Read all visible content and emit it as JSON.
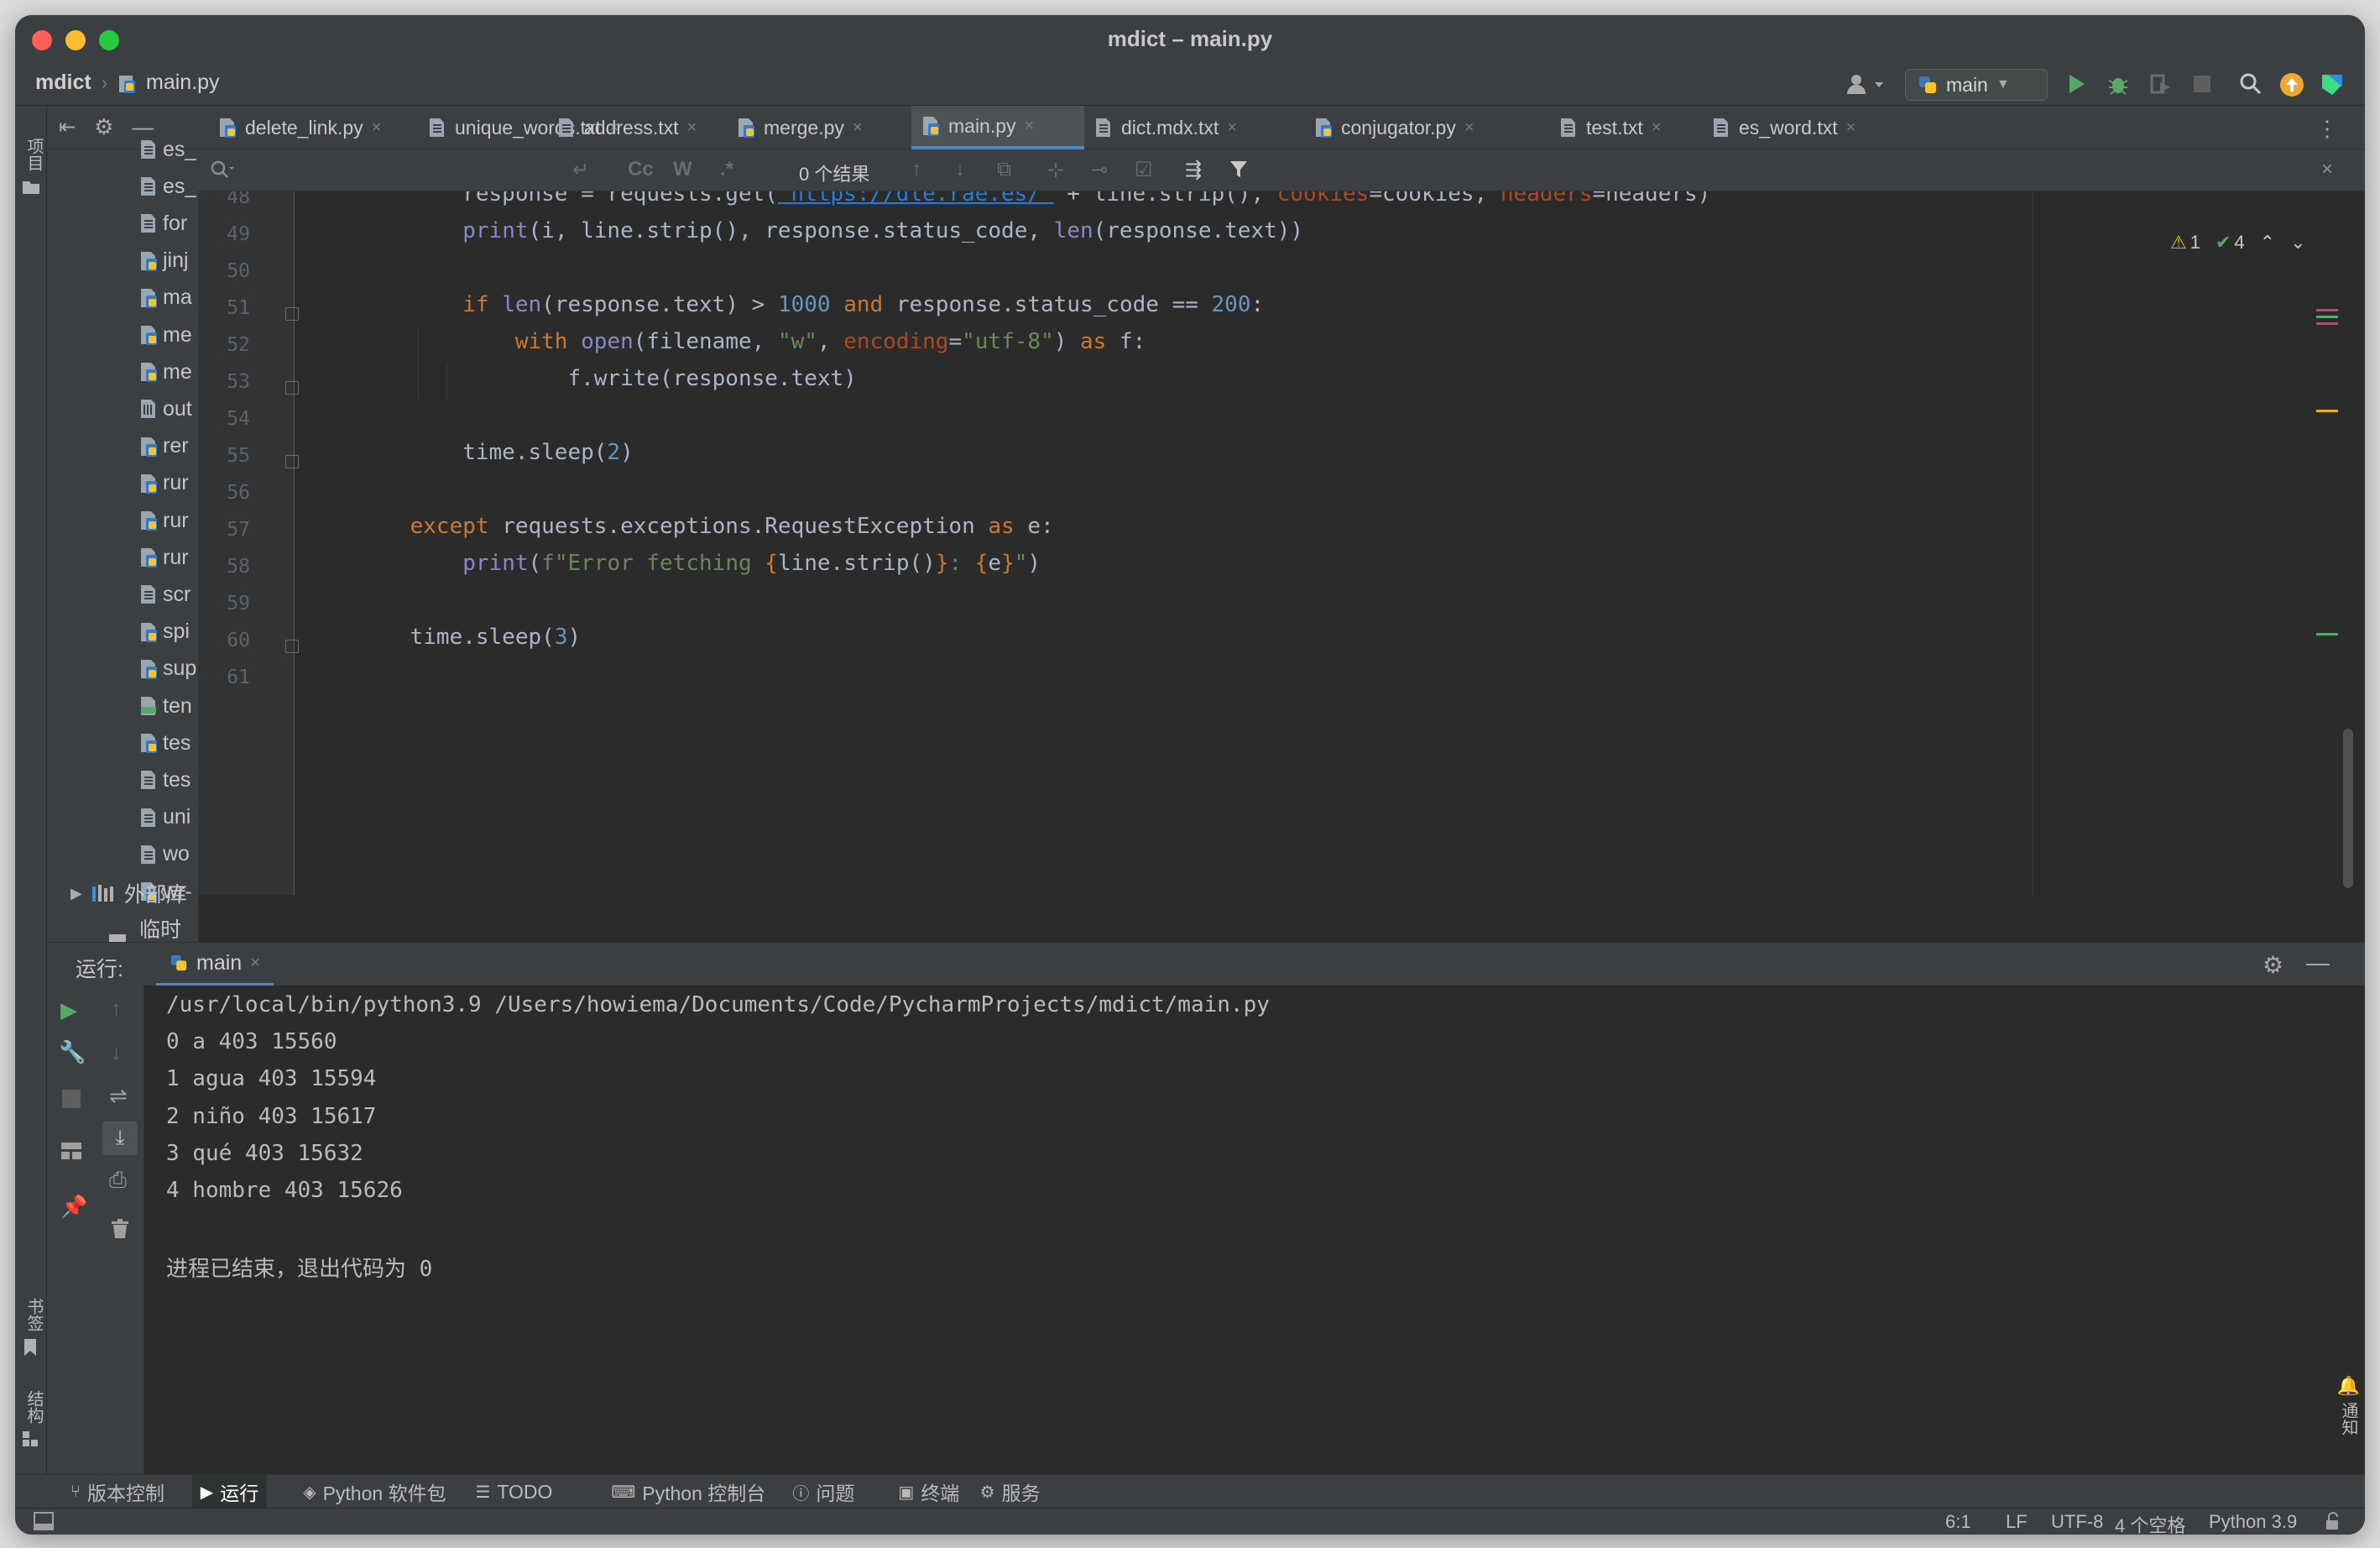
{
  "window": {
    "title": "mdict – main.py",
    "traffic_lights": {
      "close": "#ff5f57",
      "minimize": "#febc2e",
      "zoom": "#28c840"
    }
  },
  "navbar": {
    "project": "mdict",
    "file": "main.py",
    "run_config": "main",
    "icons": [
      "user-icon",
      "run-icon",
      "debug-icon",
      "coverage-icon",
      "stop-icon",
      "search-icon",
      "update-icon",
      "jetbrains-logo-icon"
    ]
  },
  "left_strip": {
    "project_label": "项目",
    "bookmarks_label": "书签",
    "structure_label": "结构"
  },
  "project_tree": {
    "items": [
      {
        "label": "es_",
        "icon": "text-file-icon"
      },
      {
        "label": "es_",
        "icon": "text-file-icon"
      },
      {
        "label": "for",
        "icon": "text-file-icon"
      },
      {
        "label": "jinj",
        "icon": "python-file-icon"
      },
      {
        "label": "ma",
        "icon": "python-file-icon"
      },
      {
        "label": "me",
        "icon": "python-file-icon"
      },
      {
        "label": "me",
        "icon": "python-file-icon"
      },
      {
        "label": "out",
        "icon": "binary-file-icon"
      },
      {
        "label": "rer",
        "icon": "python-file-icon"
      },
      {
        "label": "rur",
        "icon": "python-file-icon"
      },
      {
        "label": "rur",
        "icon": "python-file-icon"
      },
      {
        "label": "rur",
        "icon": "python-file-icon"
      },
      {
        "label": "scr",
        "icon": "text-file-icon"
      },
      {
        "label": "spi",
        "icon": "python-file-icon"
      },
      {
        "label": "sup",
        "icon": "python-file-icon"
      },
      {
        "label": "ten",
        "icon": "html-file-icon"
      },
      {
        "label": "tes",
        "icon": "python-file-icon"
      },
      {
        "label": "tes",
        "icon": "text-file-icon"
      },
      {
        "label": "uni",
        "icon": "text-file-icon"
      },
      {
        "label": "wo",
        "icon": "text-file-icon"
      },
      {
        "label": "wr-",
        "icon": "python-file-icon"
      }
    ],
    "external_libraries": "外部库",
    "scratches": "临时文"
  },
  "tabs": [
    {
      "label": "delete_link.py",
      "icon": "python-file-icon",
      "active": false
    },
    {
      "label": "unique_words.txt",
      "icon": "text-file-icon",
      "active": false
    },
    {
      "label": "address.txt",
      "icon": "text-file-icon",
      "active": false
    },
    {
      "label": "merge.py",
      "icon": "python-file-icon",
      "active": false
    },
    {
      "label": "main.py",
      "icon": "python-file-icon",
      "active": true
    },
    {
      "label": "dict.mdx.txt",
      "icon": "text-file-icon",
      "active": false
    },
    {
      "label": "conjugator.py",
      "icon": "python-file-icon",
      "active": false
    },
    {
      "label": "test.txt",
      "icon": "text-file-icon",
      "active": false
    },
    {
      "label": "es_word.txt",
      "icon": "text-file-icon",
      "active": false
    }
  ],
  "find_bar": {
    "query": "",
    "results": "0 个结果",
    "match_case": "Cc",
    "words": "W",
    "regex": ".*"
  },
  "inspections": {
    "warnings": "1",
    "ok": "4"
  },
  "editor": {
    "line_numbers": [
      "48",
      "49",
      "50",
      "51",
      "52",
      "53",
      "54",
      "55",
      "56",
      "57",
      "58",
      "59",
      "60",
      "61"
    ],
    "lines": [
      [
        {
          "t": "        response = requests.get(",
          "c": ""
        },
        {
          "t": "\"https://dle.rae.es/\"",
          "c": "url"
        },
        {
          "t": " + line.strip(), ",
          "c": ""
        },
        {
          "t": "cookies",
          "c": "pm"
        },
        {
          "t": "=cookies, ",
          "c": ""
        },
        {
          "t": "headers",
          "c": "pm"
        },
        {
          "t": "=headers)",
          "c": ""
        }
      ],
      [
        {
          "t": "        ",
          "c": ""
        },
        {
          "t": "print",
          "c": "bi"
        },
        {
          "t": "(i, line.strip(), response.status_code, ",
          "c": ""
        },
        {
          "t": "len",
          "c": "bi"
        },
        {
          "t": "(response.text))",
          "c": ""
        }
      ],
      [],
      [
        {
          "t": "        ",
          "c": ""
        },
        {
          "t": "if ",
          "c": "kw"
        },
        {
          "t": "len",
          "c": "bi"
        },
        {
          "t": "(response.text) > ",
          "c": ""
        },
        {
          "t": "1000 ",
          "c": "num"
        },
        {
          "t": "and ",
          "c": "kw"
        },
        {
          "t": "response.status_code == ",
          "c": ""
        },
        {
          "t": "200",
          "c": "num"
        },
        {
          "t": ":",
          "c": ""
        }
      ],
      [
        {
          "t": "            ",
          "c": ""
        },
        {
          "t": "with ",
          "c": "kw"
        },
        {
          "t": "open",
          "c": "bi"
        },
        {
          "t": "(filename, ",
          "c": ""
        },
        {
          "t": "\"w\"",
          "c": "str"
        },
        {
          "t": ", ",
          "c": ""
        },
        {
          "t": "encoding",
          "c": "pm"
        },
        {
          "t": "=",
          "c": ""
        },
        {
          "t": "\"utf-8\"",
          "c": "str"
        },
        {
          "t": ") ",
          "c": ""
        },
        {
          "t": "as ",
          "c": "kw"
        },
        {
          "t": "f:",
          "c": ""
        }
      ],
      [
        {
          "t": "                f.write(response.text)",
          "c": ""
        }
      ],
      [],
      [
        {
          "t": "        time.sleep(",
          "c": ""
        },
        {
          "t": "2",
          "c": "num"
        },
        {
          "t": ")",
          "c": ""
        }
      ],
      [],
      [
        {
          "t": "    ",
          "c": ""
        },
        {
          "t": "except ",
          "c": "kw"
        },
        {
          "t": "requests.exceptions.RequestException ",
          "c": ""
        },
        {
          "t": "as ",
          "c": "kw"
        },
        {
          "t": "e:",
          "c": ""
        }
      ],
      [
        {
          "t": "        ",
          "c": ""
        },
        {
          "t": "print",
          "c": "bi"
        },
        {
          "t": "(",
          "c": ""
        },
        {
          "t": "f\"Error fetching ",
          "c": "str"
        },
        {
          "t": "{",
          "c": "kw"
        },
        {
          "t": "line.strip()",
          "c": ""
        },
        {
          "t": "}",
          "c": "kw"
        },
        {
          "t": ": ",
          "c": "str"
        },
        {
          "t": "{",
          "c": "kw"
        },
        {
          "t": "e",
          "c": ""
        },
        {
          "t": "}",
          "c": "kw"
        },
        {
          "t": "\"",
          "c": "str"
        },
        {
          "t": ")",
          "c": ""
        }
      ],
      [],
      [
        {
          "t": "    time.sleep(",
          "c": ""
        },
        {
          "t": "3",
          "c": "num"
        },
        {
          "t": ")",
          "c": ""
        }
      ],
      []
    ]
  },
  "run_panel": {
    "label": "运行:",
    "tab": "main",
    "output": [
      "/usr/local/bin/python3.9 /Users/howiema/Documents/Code/PycharmProjects/mdict/main.py",
      "0 a 403 15560",
      "1 agua 403 15594",
      "2 niño 403 15617",
      "3 qué 403 15632",
      "4 hombre 403 15626",
      "",
      "进程已结束，退出代码为 0"
    ],
    "notifications_label": "通知"
  },
  "tool_windows": [
    {
      "label": "版本控制",
      "icon": "vcs-branch-icon",
      "active": false
    },
    {
      "label": "运行",
      "icon": "run-icon",
      "active": true
    },
    {
      "label": "Python 软件包",
      "icon": "layers-icon",
      "active": false
    },
    {
      "label": "TODO",
      "icon": "list-icon",
      "active": false
    },
    {
      "label": "Python 控制台",
      "icon": "python-console-icon",
      "active": false
    },
    {
      "label": "问题",
      "icon": "info-icon",
      "active": false
    },
    {
      "label": "终端",
      "icon": "terminal-icon",
      "active": false
    },
    {
      "label": "服务",
      "icon": "services-icon",
      "active": false
    }
  ],
  "status_bar": {
    "position": "6:1",
    "line_separator": "LF",
    "encoding": "UTF-8",
    "indent": "4 个空格",
    "interpreter": "Python 3.9"
  },
  "colors": {
    "bg": "#2b2b2b",
    "chrome": "#3c3f41",
    "keyword": "#cc7832",
    "number": "#6897bb",
    "string": "#6a8759",
    "param": "#aa4926",
    "builtin": "#8888c6",
    "accent": "#4a88c7"
  }
}
